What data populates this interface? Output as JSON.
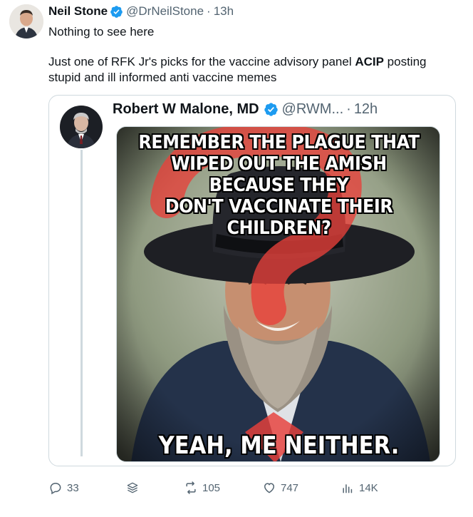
{
  "tweet": {
    "author_name": "Neil Stone",
    "author_handle": "@DrNeilStone",
    "separator": "·",
    "time": "13h",
    "line1": "Nothing to see here",
    "line2_prefix": "Just one of RFK Jr's picks for the vaccine advisory panel ",
    "line2_bold": "ACIP",
    "line2_suffix": "  posting stupid and ill informed anti vaccine memes"
  },
  "quoted": {
    "author_name": "Robert W Malone, MD",
    "author_handle": "@RWM...",
    "separator": "·",
    "time": "12h",
    "meme_top_lines": [
      "REMEMBER THE PLAGUE THAT",
      "WIPED OUT THE AMISH BECAUSE THEY",
      "DON'T VACCINATE THEIR CHILDREN?"
    ],
    "meme_bottom": "YEAH, ME NEITHER."
  },
  "actions": {
    "replies": "33",
    "retweets": "105",
    "likes": "747",
    "views": "14K"
  },
  "colors": {
    "verified_blue": "#1d9bf0",
    "muted_text": "#536471",
    "scribble_red": "#e8403a",
    "border": "#cfd9de"
  },
  "icons": {
    "reply": "reply-icon",
    "stack": "layers-icon",
    "retweet": "retweet-icon",
    "like": "heart-icon",
    "views": "analytics-icon",
    "verified": "verified-badge-icon"
  }
}
